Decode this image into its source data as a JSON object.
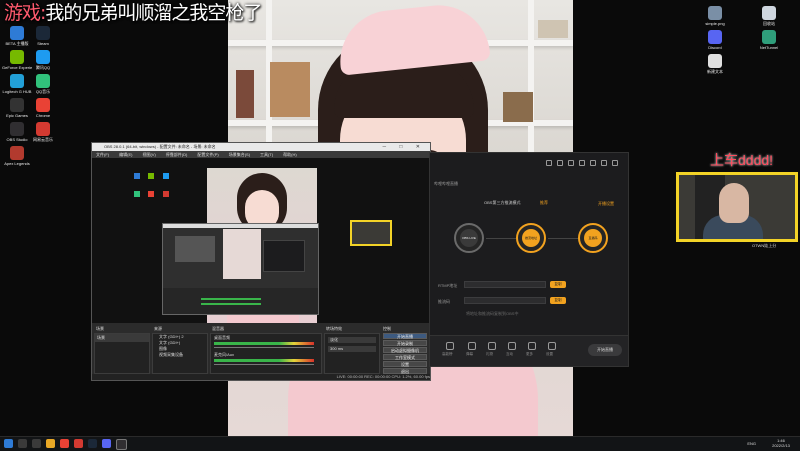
{
  "overlay": {
    "title_label": "游戏:",
    "title_main": "我的兄弟叫顺溜之我空枪了",
    "tag": "上车dddd!",
    "cam_caption": "OTWN娃上分"
  },
  "desktop_left": [
    {
      "label": "BETA 主播版",
      "color": "#2e7bd6"
    },
    {
      "label": "Steam",
      "color": "#1b2838"
    },
    {
      "label": "GeForce Experience",
      "color": "#76b900"
    },
    {
      "label": "腾讯QQ",
      "color": "#1e9bf0"
    },
    {
      "label": "Logitech G HUB",
      "color": "#22a0d8"
    },
    {
      "label": "QQ音乐",
      "color": "#31c27c"
    },
    {
      "label": "Epic Games",
      "color": "#333333"
    },
    {
      "label": "Chrome",
      "color": "#e94235"
    },
    {
      "label": "OBS Studio",
      "color": "#302e31"
    },
    {
      "label": "网易云音乐",
      "color": "#d33a31"
    },
    {
      "label": "Apex Legends",
      "color": "#b23a2e"
    }
  ],
  "desktop_right": [
    {
      "label": "simple.png",
      "color": "#7a8fa6"
    },
    {
      "label": "回收站",
      "color": "#cfd6df"
    },
    {
      "label": "Discord",
      "color": "#5865f2"
    },
    {
      "label": "NetTunnel",
      "color": "#2f9e7b"
    },
    {
      "label": "新建文本",
      "color": "#e0e0e0"
    }
  ],
  "obs": {
    "title": "OBS 28.0.1 (64-bit, windows) - 配置文件: 未命名 - 场景: 未命名",
    "menu": [
      "文件(F)",
      "编辑(E)",
      "视图(V)",
      "停靠部件(D)",
      "配置文件(P)",
      "场景集合(S)",
      "工具(T)",
      "帮助(H)"
    ],
    "docks": [
      "场景",
      "来源",
      "混音器",
      "转场特效",
      "控制"
    ],
    "scene_item": "场景",
    "sources": [
      "文字 (GDI+) 2",
      "文字 (GDI+)",
      "图像",
      "视频采集设备"
    ],
    "mixer": [
      "桌面音频",
      "麦克风/Aux"
    ],
    "transition": "淡化",
    "duration": "300 ms",
    "controls": [
      "开始直播",
      "开始录制",
      "启动虚拟摄像机",
      "工作室模式",
      "设置",
      "退出"
    ],
    "status": "LIVE: 00:00:00   REC: 00:00:00   CPU: 1.2%, 60.00 fps"
  },
  "app": {
    "header_left": "哔哩哔哩直播",
    "header_right": "开播设置",
    "mode_title": "OBS第三方推流模式",
    "mode_tag": "推荐",
    "modes": [
      "OBS LIVE",
      "推流地址",
      "直播码"
    ],
    "rtmp_label": "RTMP地址",
    "key_label": "推流码",
    "copy": "复制",
    "hint": "将地址和推流码复制到OBS中",
    "bottom_items": [
      "高能榜",
      "弹幕",
      "礼物",
      "互动",
      "更多",
      "设置"
    ],
    "start": "开始直播"
  },
  "taskbar": {
    "time": "1:46",
    "date": "2022/2/13",
    "lang": "ENG"
  }
}
